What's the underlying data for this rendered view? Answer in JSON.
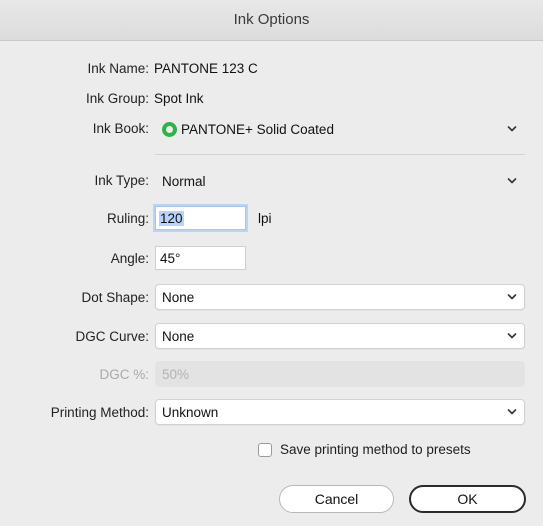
{
  "window": {
    "title": "Ink Options"
  },
  "ink_name": {
    "label": "Ink Name:",
    "value": "PANTONE 123 C"
  },
  "ink_group": {
    "label": "Ink Group:",
    "value": "Spot Ink"
  },
  "ink_book": {
    "label": "Ink Book:",
    "value": "PANTONE+ Solid Coated",
    "icon": "green-circle-icon",
    "icon_color": "#2fb443"
  },
  "ink_type": {
    "label": "Ink Type:",
    "value": "Normal"
  },
  "ruling": {
    "label": "Ruling:",
    "value": "120",
    "unit": "lpi"
  },
  "angle": {
    "label": "Angle:",
    "value": "45°"
  },
  "dot_shape": {
    "label": "Dot Shape:",
    "value": "None"
  },
  "dgc_curve": {
    "label": "DGC Curve:",
    "value": "None"
  },
  "dgc_percent": {
    "label": "DGC %:",
    "value": "50%"
  },
  "printing_method": {
    "label": "Printing Method:",
    "value": "Unknown"
  },
  "save_presets": {
    "label": "Save printing method to presets",
    "checked": false
  },
  "buttons": {
    "cancel": "Cancel",
    "ok": "OK"
  }
}
